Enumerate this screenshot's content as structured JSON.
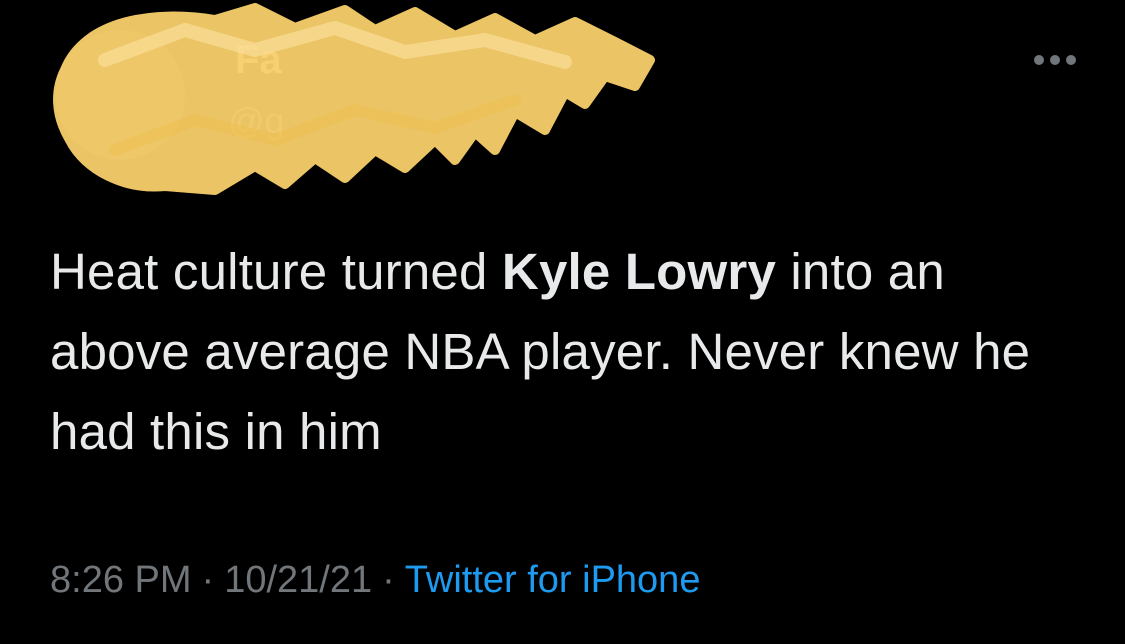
{
  "tweet": {
    "author": {
      "display_name": "Fa",
      "handle": "@g"
    },
    "more_icon": "more-horizontal-icon",
    "text": {
      "before": "Heat culture turned ",
      "bold": "Kyle Lowry",
      "after": " into an above average NBA player. Never knew he had this in him"
    },
    "meta": {
      "time": "8:26 PM",
      "separator": "·",
      "date": "10/21/21",
      "source": "Twitter for iPhone"
    }
  },
  "colors": {
    "background": "#000000",
    "text": "#e7e9ea",
    "secondary_text": "#71767b",
    "link": "#1d9bf0",
    "redaction": "#f7cf6b"
  }
}
